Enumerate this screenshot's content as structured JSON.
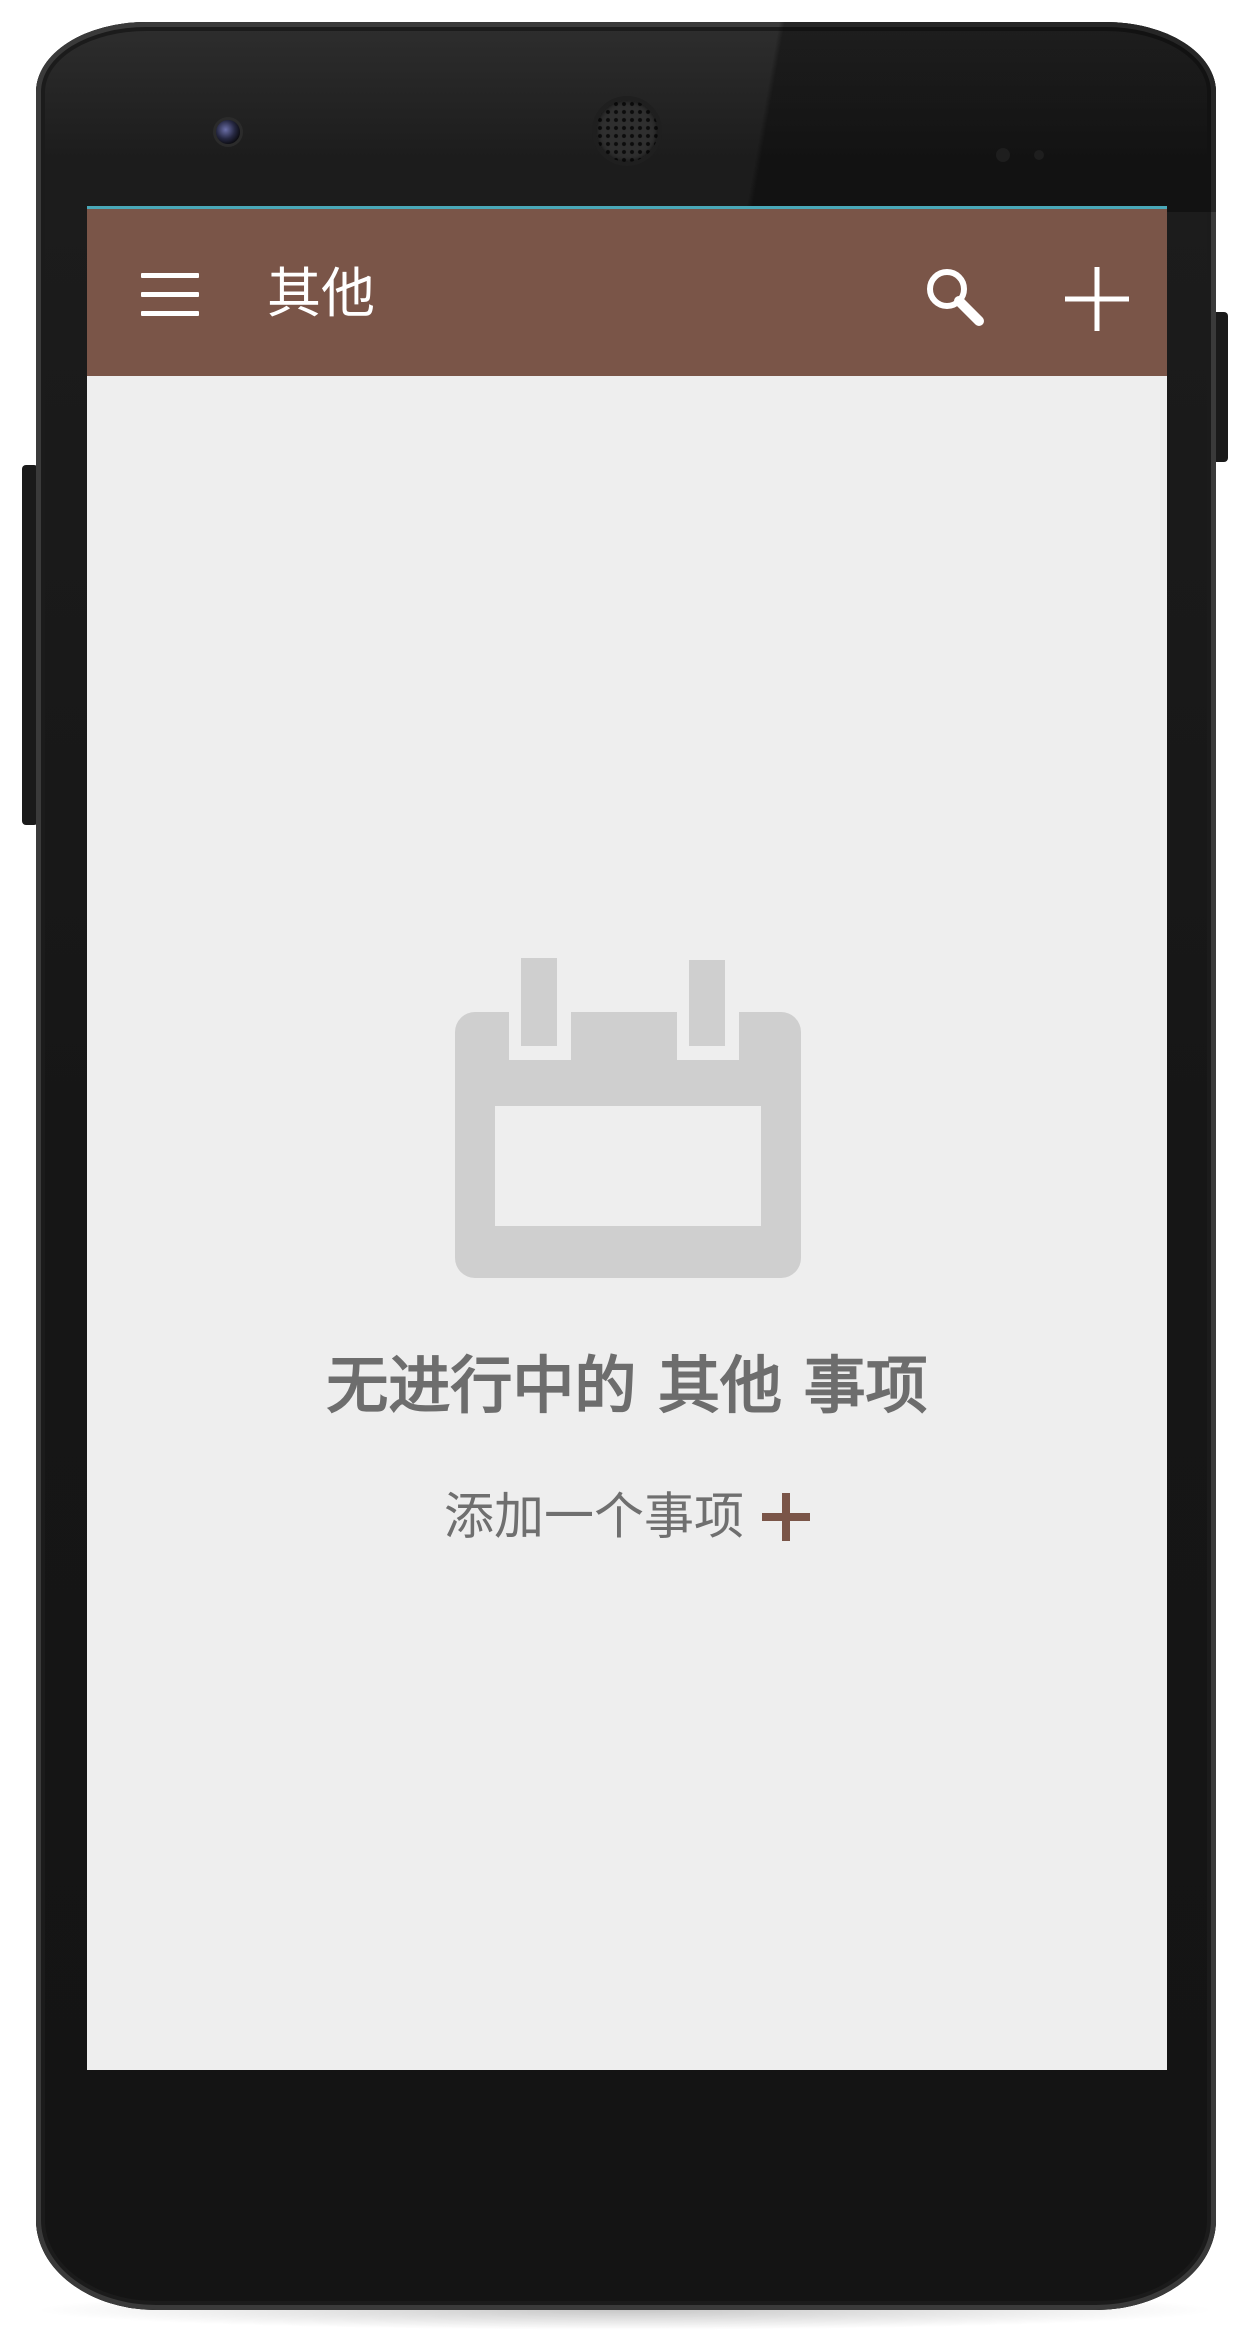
{
  "toolbar": {
    "title": "其他",
    "menu_icon": "hamburger-menu-icon",
    "search_icon": "search-icon",
    "add_icon": "plus-icon",
    "background_color": "#7a5548"
  },
  "empty_state": {
    "icon": "calendar-icon",
    "title": "无进行中的 其他 事项",
    "add_label": "添加一个事项",
    "add_icon": "plus-icon",
    "accent_color": "#7a5548"
  }
}
